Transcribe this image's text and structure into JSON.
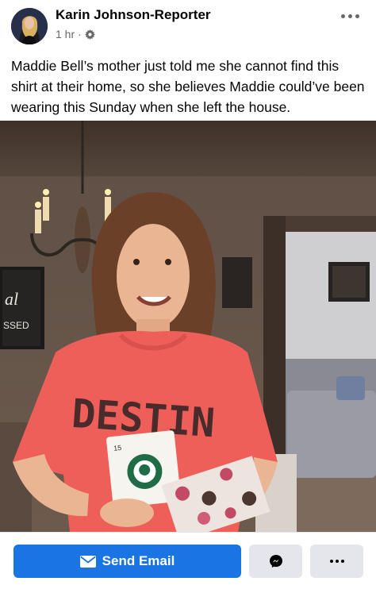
{
  "post": {
    "author": "Karin Johnson-Reporter",
    "time": "1 hr",
    "separator": "·",
    "audience_icon": "gear-icon",
    "options_icon": "more-horizontal-icon",
    "caption": "Maddie Bell’s mother just told me she cannot find this shirt at their home, so she believes Maddie could’ve been wearing this Sunday when she left the house.",
    "photo": {
      "shirt_text": "DESTIN",
      "card_number": "15",
      "sign_text_top": "al",
      "sign_text_bottom": "SSED"
    }
  },
  "actions": {
    "send_email_label": "Send Email",
    "send_email_icon": "envelope-icon",
    "messenger_icon": "messenger-icon",
    "more_icon": "more-horizontal-icon"
  },
  "colors": {
    "primary": "#1b74e4",
    "secondary_button": "#e4e6eb",
    "meta_text": "#65676b",
    "shirt": "#ef5f5a"
  }
}
